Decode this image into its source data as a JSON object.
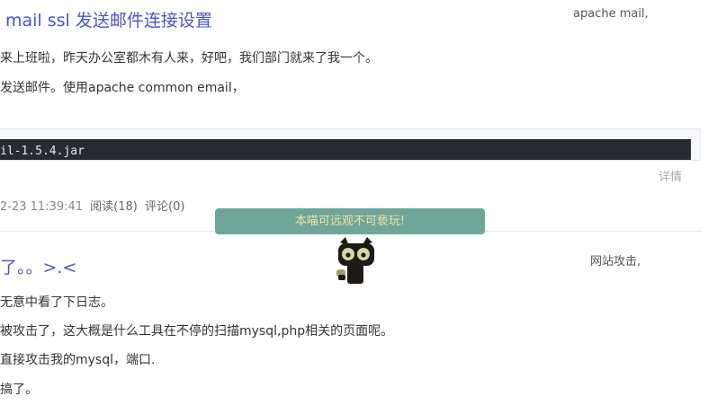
{
  "post1": {
    "title": "mail ssl 发送邮件连接设置",
    "tags": "apache mail,",
    "paragraphs": [
      "来上班啦，昨天办公室都木有人来，好吧，我们部门就来了我一个。",
      "发送邮件。使用apache common email，"
    ],
    "code_line": "il-1.5.4.jar",
    "detail_link": "详情",
    "meta": {
      "date": "2-23 11:39:41",
      "reads": "阅读(18)",
      "comments": "评论(0)"
    }
  },
  "mascot": {
    "tooltip": "本喵可远观不可亵玩!",
    "icon": "black-cat-icon"
  },
  "post2": {
    "title": "了。。>.<",
    "tags": "网站攻击,",
    "paragraphs": [
      "无意中看了下日志。",
      "被攻击了，这大概是什么工具在不停的扫描mysql,php相关的页面呢。",
      "直接攻击我的mysql，端口.",
      "搞了。"
    ]
  }
}
